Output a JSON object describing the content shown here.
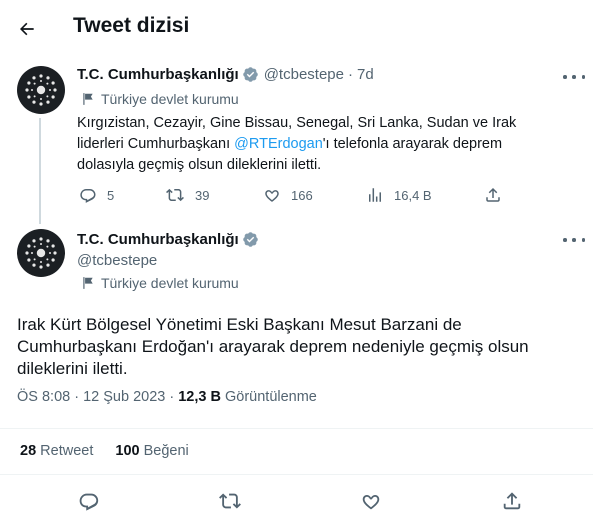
{
  "header": {
    "title": "Tweet dizisi"
  },
  "tweet1": {
    "name": "T.C. Cumhurbaşkanlığı",
    "handle": "@tcbestepe",
    "time": "7d",
    "gov_label": "Türkiye devlet kurumu",
    "text_before": "Kırgızistan, Cezayir, Gine Bissau, Senegal, Sri Lanka, Sudan ve Irak liderleri  Cumhurbaşkanı ",
    "mention": "@RTErdogan",
    "text_after": "'ı telefonla arayarak deprem dolasıyla geçmiş olsun dileklerini iletti.",
    "replies": "5",
    "retweets": "39",
    "likes": "166",
    "views": "16,4 B"
  },
  "tweet2": {
    "name": "T.C. Cumhurbaşkanlığı",
    "handle": "@tcbestepe",
    "gov_label": "Türkiye devlet kurumu",
    "text": "Irak Kürt Bölgesel Yönetimi Eski Başkanı Mesut Barzani de Cumhurbaşkanı Erdoğan'ı arayarak deprem nedeniyle geçmiş olsun dileklerini iletti.",
    "timestamp": "ÖS 8:08 · 12 Şub 2023",
    "view_sep": " · ",
    "views": "12,3 B",
    "views_label": "Görüntülenme",
    "retweet_count": "28",
    "retweet_label": "Retweet",
    "like_count": "100",
    "like_label": "Beğeni"
  },
  "colors": {
    "accent": "#1d9bf0",
    "muted": "#536471",
    "verified_gray": "#829aab",
    "text": "#0f1419"
  },
  "icons": [
    "back-arrow-icon",
    "verified-badge-icon",
    "government-flag-icon",
    "more-icon",
    "reply-icon",
    "retweet-icon",
    "like-icon",
    "views-icon",
    "share-icon"
  ]
}
